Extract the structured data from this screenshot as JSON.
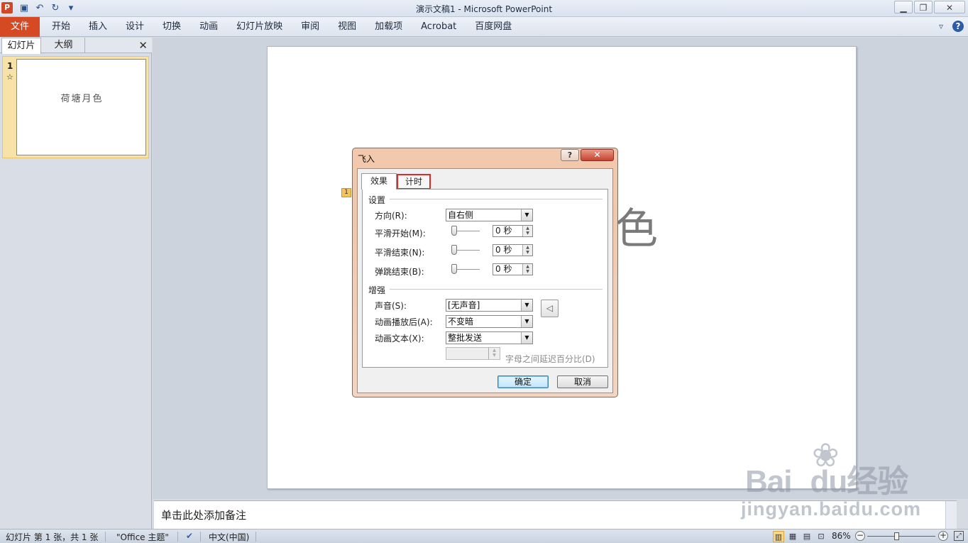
{
  "app": {
    "icon_letter": "P",
    "title": "演示文稿1  -  Microsoft PowerPoint",
    "quick_access": [
      "save-icon",
      "undo-icon",
      "redo-icon",
      "customize-icon"
    ],
    "window_controls": [
      "minimize",
      "restore",
      "close"
    ]
  },
  "ribbon": {
    "file_tab": "文件",
    "tabs": [
      "开始",
      "插入",
      "设计",
      "切换",
      "动画",
      "幻灯片放映",
      "审阅",
      "视图",
      "加载项",
      "Acrobat",
      "百度网盘"
    ]
  },
  "left_pane": {
    "tabs": [
      "幻灯片",
      "大纲"
    ],
    "close_glyph": "✕",
    "thumbnail": {
      "number": "1",
      "star": "☆",
      "text": "荷塘月色"
    }
  },
  "slide": {
    "visible_char": "色",
    "animation_badge": "1"
  },
  "dialog": {
    "title": "飞入",
    "help_glyph": "?",
    "close_glyph": "✕",
    "tabs": [
      "效果",
      "计时"
    ],
    "settings_group": "设置",
    "direction_label": "方向(R):",
    "direction_value": "自右侧",
    "smooth_start_label": "平滑开始(M):",
    "smooth_start_value": "0 秒",
    "smooth_end_label": "平滑结束(N):",
    "smooth_end_value": "0 秒",
    "bounce_end_label": "弹跳结束(B):",
    "bounce_end_value": "0 秒",
    "enhance_group": "增强",
    "sound_label": "声音(S):",
    "sound_value": "[无声音]",
    "after_anim_label": "动画播放后(A):",
    "after_anim_value": "不变暗",
    "anim_text_label": "动画文本(X):",
    "anim_text_value": "整批发送",
    "delay_hint": "字母之间延迟百分比(D)",
    "ok": "确定",
    "cancel": "取消"
  },
  "notes": {
    "placeholder": "单击此处添加备注"
  },
  "status": {
    "slide_info": "幻灯片 第 1 张，共 1 张",
    "theme": "\"Office 主题\"",
    "language": "中文(中国)",
    "zoom": "86%"
  },
  "watermark": {
    "brand": "Bai",
    "brand2": "du",
    "brand_cn": "经验",
    "sub": "jingyan.baidu.com"
  }
}
